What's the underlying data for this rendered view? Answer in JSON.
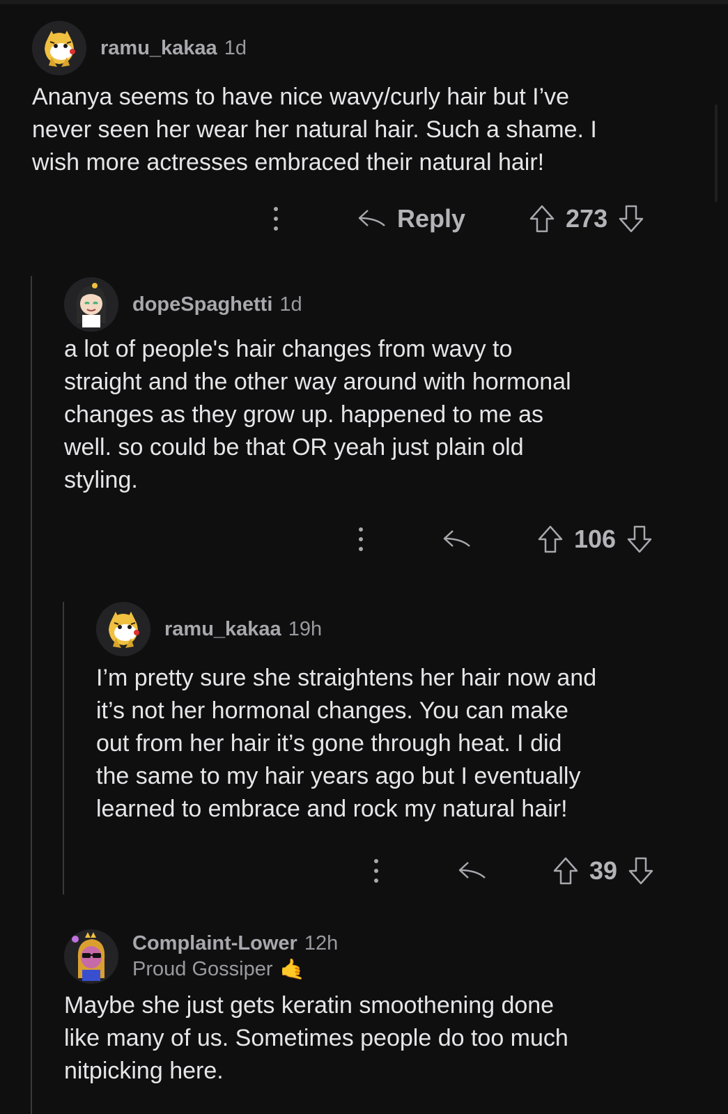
{
  "comments": [
    {
      "username": "ramu_kakaa",
      "time": "1d",
      "body": "Ananya seems to have nice wavy/curly hair but I’ve\nnever seen her wear her natural hair. Such a shame. I\nwish more actresses embraced their natural hair!",
      "reply_label": "Reply",
      "score": "273",
      "avatar_icon": "tiger-avatar-icon"
    },
    {
      "username": "dopeSpaghetti",
      "time": "1d",
      "body": "a lot of people's hair changes from wavy to\nstraight and the other way around with hormonal\nchanges as they grow up. happened to me as\nwell. so could be that OR yeah just plain old\nstyling.",
      "score": "106",
      "avatar_icon": "girl-avatar-icon"
    },
    {
      "username": "ramu_kakaa",
      "time": "19h",
      "body": "I’m pretty sure she straightens her hair now and\nit’s not her hormonal changes. You can make\nout from her hair it’s gone through heat. I did\nthe same to my hair years ago but I eventually\nlearned to embrace and rock my natural hair!",
      "score": "39",
      "avatar_icon": "tiger-avatar-icon"
    },
    {
      "username": "Complaint-Lower",
      "time": "12h",
      "flair": "Proud Gossiper",
      "flair_emoji": "🤙",
      "body": "Maybe she just gets keratin smoothening done\nlike many of us. Sometimes people do too much\nnitpicking here.",
      "avatar_icon": "sunglasses-avatar-icon"
    }
  ],
  "colors": {
    "background": "#0f0f10",
    "text": "#e6e6e8",
    "muted": "#a8a8ad",
    "thread_line": "#3a3a3c"
  }
}
